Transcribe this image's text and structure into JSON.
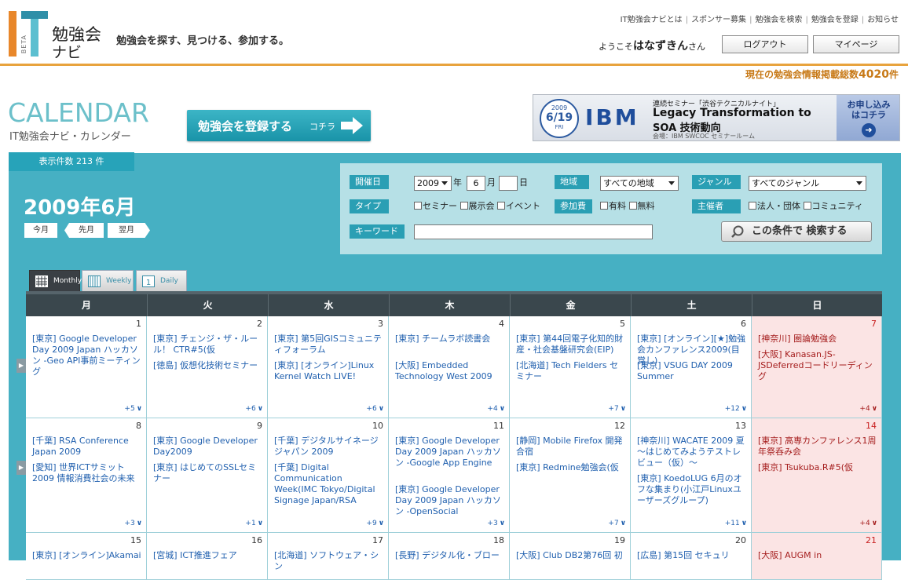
{
  "header": {
    "logo_letters": "IT",
    "logo_beta": "BETA",
    "logo_name_1": "勉強会",
    "logo_name_2": "ナビ",
    "tagline": "勉強会を探す、見つける、参加する。",
    "nav": [
      "IT勉強会ナビとは",
      "スポンサー募集",
      "勉強会を検索",
      "勉強会を登録",
      "お知らせ"
    ],
    "welcome_prefix": "ようこそ",
    "welcome_user": "はなずきん",
    "welcome_suffix": "さん",
    "logout": "ログアウト",
    "mypage": "マイページ",
    "count_prefix": "現在の勉強会情報掲載総数",
    "count_value": "4020",
    "count_suffix": "件",
    "accent_color": "#e8a33d"
  },
  "title": {
    "main": "CALENDAR",
    "sub": "IT勉強会ナビ・カレンダー",
    "register_main": "勉強会を登録する",
    "register_sub": "コチラ"
  },
  "banner": {
    "year": "2009",
    "month_day": "6/19",
    "weekday": "FRI",
    "brand": "IBM",
    "line1": "連続セミナー「渋谷テクニカルナイト」",
    "line2": "Legacy Transformation to",
    "line3": "SOA 技術動向",
    "line4": "会場：IBM SWCOC セミナールーム",
    "apply_1": "お申し込み",
    "apply_2": "はコチラ"
  },
  "panel": {
    "result_count": "表示件数 213 件",
    "month_label": "2009年6月",
    "today": "今月",
    "prev": "先月",
    "next": "翌月",
    "color": "#46b0c3"
  },
  "search": {
    "date_label": "開催日",
    "year": "2009",
    "year_unit": "年",
    "month": "6",
    "month_unit": "月",
    "day": "",
    "day_unit": "日",
    "region_label": "地域",
    "region_value": "すべての地域",
    "genre_label": "ジャンル",
    "genre_value": "すべてのジャンル",
    "type_label": "タイプ",
    "type_options": [
      "セミナー",
      "展示会",
      "イベント"
    ],
    "fee_label": "参加費",
    "fee_options": [
      "有料",
      "無料"
    ],
    "host_label": "主催者",
    "host_options": [
      "法人・団体",
      "コミュニティ"
    ],
    "keyword_label": "キーワード",
    "keyword_value": "",
    "search_button": "この条件で 検索する"
  },
  "view_tabs": [
    "Monthly",
    "Weekly",
    "Daily"
  ],
  "view_tab_daily_num": "1",
  "calendar": {
    "weekdays": [
      "月",
      "火",
      "水",
      "木",
      "金",
      "土",
      "日"
    ],
    "weeks": [
      [
        {
          "day": "1",
          "events": [
            "[東京] Google Developer Day 2009 Japan ハッカソン -Geo API事前ミーティング"
          ],
          "more": "+5"
        },
        {
          "day": "2",
          "events": [
            "[東京] チェンジ・ザ・ルール！ CTR#5(仮",
            "[徳島] 仮想化技術セミナー"
          ],
          "more": "+6"
        },
        {
          "day": "3",
          "events": [
            "[東京] 第5回GISコミュニティフォーラム",
            "[東京] [オンライン]Linux Kernel Watch LIVE!"
          ],
          "more": "+6"
        },
        {
          "day": "4",
          "events": [
            "[東京] チームラボ読書会",
            "[大阪] Embedded Technology West 2009"
          ],
          "more": "+4"
        },
        {
          "day": "5",
          "events": [
            "[東京] 第44回電子化知的財産・社会基盤研究会(EIP)",
            "[北海道] Tech Fielders セミナー"
          ],
          "more": "+7"
        },
        {
          "day": "6",
          "events": [
            "[東京] [オンライン][★]勉強会カンファレンス2009(目覚し)",
            "[東京] VSUG DAY 2009 Summer"
          ],
          "more": "+12"
        },
        {
          "day": "7",
          "events": [
            "[神奈川] 圏論勉強会",
            "[大阪] Kanasan.JS-JSDeferredコードリーディング"
          ],
          "more": "+4"
        }
      ],
      [
        {
          "day": "8",
          "events": [
            "[千葉] RSA Conference Japan 2009",
            "[愛知] 世界ICTサミット2009 情報消費社会の未来"
          ],
          "more": "+3"
        },
        {
          "day": "9",
          "events": [
            "[東京] Google Developer Day2009",
            "[東京] はじめてのSSLセミナー"
          ],
          "more": "+1"
        },
        {
          "day": "10",
          "events": [
            "[千葉] デジタルサイネージジャパン 2009",
            "[千葉] Digital Communication Week(IMC Tokyo/Digital Signage Japan/RSA"
          ],
          "more": "+9"
        },
        {
          "day": "11",
          "events": [
            "[東京] Google Developer Day 2009 Japan ハッカソン -Google App Engine",
            "[東京] Google Developer Day 2009 Japan ハッカソン -OpenSocial"
          ],
          "more": "+3"
        },
        {
          "day": "12",
          "events": [
            "[静岡] Mobile Firefox 開発合宿",
            "[東京] Redmine勉強会(仮"
          ],
          "more": "+7"
        },
        {
          "day": "13",
          "events": [
            "[神奈川] WACATE 2009 夏 〜はじめてみようテストレビュー（仮）〜",
            "[東京] KoedoLUG 6月のオフな集まり(小江戸Linuxユーザーズグループ)"
          ],
          "more": "+11"
        },
        {
          "day": "14",
          "events": [
            "[東京] 高専カンファレンス1周年祭呑み会",
            "[東京] Tsukuba.R#5(仮"
          ],
          "more": "+4"
        }
      ],
      [
        {
          "day": "15",
          "events": [
            "[東京] [オンライン]Akamai"
          ],
          "more": ""
        },
        {
          "day": "16",
          "events": [
            "[宮城] ICT推進フェア"
          ],
          "more": ""
        },
        {
          "day": "17",
          "events": [
            "[北海道] ソフトウェア・シン"
          ],
          "more": ""
        },
        {
          "day": "18",
          "events": [
            "[長野] デジタル化・ブロー"
          ],
          "more": ""
        },
        {
          "day": "19",
          "events": [
            "[大阪] Club DB2第76回 初"
          ],
          "more": ""
        },
        {
          "day": "20",
          "events": [
            "[広島] 第15回 セキュリ"
          ],
          "more": ""
        },
        {
          "day": "21",
          "events": [
            "[大阪] AUGM in"
          ],
          "more": ""
        }
      ]
    ]
  }
}
